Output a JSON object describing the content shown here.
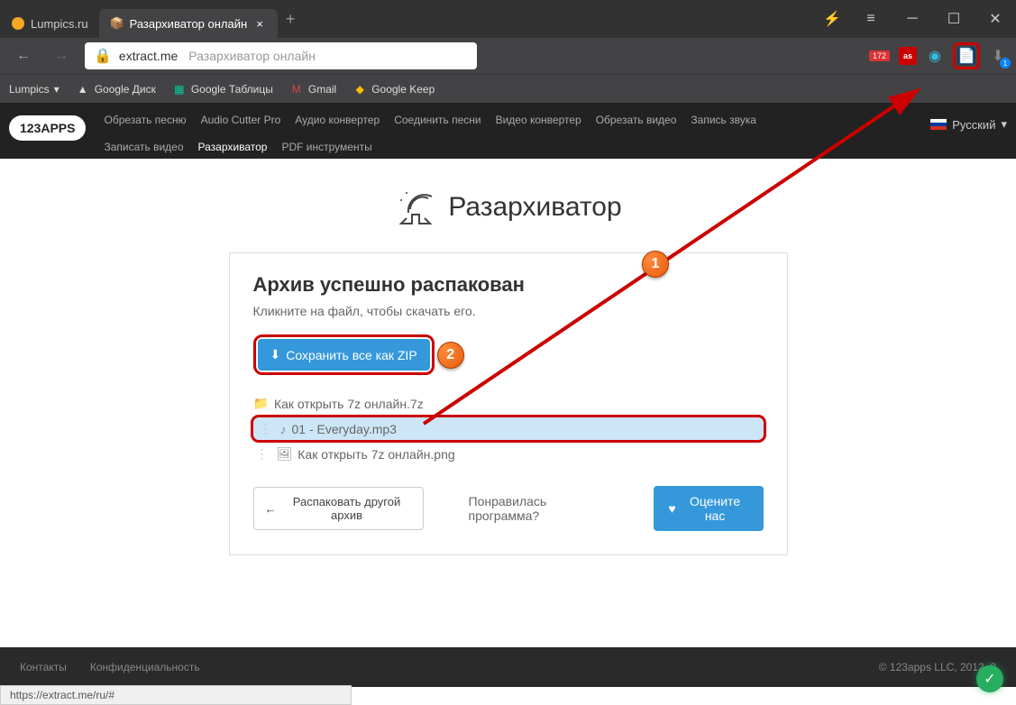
{
  "titlebar": {
    "tab_inactive": "Lumpics.ru",
    "tab_active": "Разархиватор онлайн"
  },
  "addrbar": {
    "domain": "extract.me",
    "url_title": "Разархиватор онлайн",
    "ext_badge": "172",
    "notif_count": "1"
  },
  "bookmarks": {
    "b0": "Lumpics",
    "b1": "Google Диск",
    "b2": "Google Таблицы",
    "b3": "Gmail",
    "b4": "Google Keep"
  },
  "sitenav": {
    "logo": "123APPS",
    "n0": "Обрезать песню",
    "n1": "Audio Cutter Pro",
    "n2": "Аудио конвертер",
    "n3": "Соединить песни",
    "n4": "Видео конвертер",
    "n5": "Обрезать видео",
    "n6": "Запись звука",
    "n7": "Записать видео",
    "n8": "Разархиватор",
    "n9": "PDF инструменты",
    "lang": "Русский"
  },
  "page": {
    "title": "Разархиватор",
    "heading": "Архив успешно распакован",
    "hint": "Кликните на файл, чтобы скачать его.",
    "zip_btn": "Сохранить все как ZIP",
    "tree_root": "Как открыть 7z онлайн.7z",
    "tree_file1": "01 - Everyday.mp3",
    "tree_file2": "Как открыть 7z онлайн.png",
    "unpack_other": "Распаковать другой архив",
    "like_q": "Понравилась программа?",
    "rate": "Оцените нас"
  },
  "footer": {
    "contacts": "Контакты",
    "privacy": "Конфиденциальность",
    "copyright": "© 123apps LLC, 2012–2"
  },
  "statusbar": "https://extract.me/ru/#",
  "annotation": {
    "badge1": "1",
    "badge2": "2"
  }
}
